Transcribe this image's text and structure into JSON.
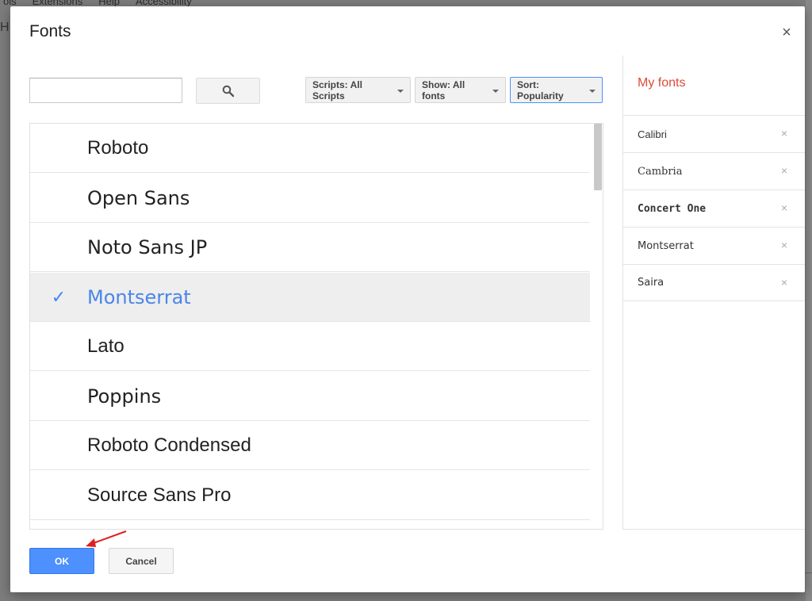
{
  "background": {
    "menu_items": [
      "ols",
      "Extensions",
      "Help",
      "Accessibility"
    ],
    "left_fragment": "He"
  },
  "dialog": {
    "title": "Fonts",
    "close_glyph": "×"
  },
  "search": {
    "value": "",
    "placeholder": "",
    "button_icon": "search-icon"
  },
  "filters": {
    "scripts_label": "Scripts: All Scripts",
    "show_label": "Show: All fonts",
    "sort_label": "Sort: Popularity"
  },
  "font_list": {
    "selected_index": 3,
    "check_glyph": "✓",
    "items": [
      {
        "label": "Roboto",
        "font": "\"Liberation Sans\", sans-serif"
      },
      {
        "label": "Open Sans",
        "font": "\"DejaVu Sans\", sans-serif"
      },
      {
        "label": "Noto Sans JP",
        "font": "\"DejaVu Sans\", sans-serif"
      },
      {
        "label": "Montserrat",
        "font": "\"DejaVu Sans\", sans-serif"
      },
      {
        "label": "Lato",
        "font": "\"Liberation Sans\", sans-serif"
      },
      {
        "label": "Poppins",
        "font": "\"DejaVu Sans\", sans-serif"
      },
      {
        "label": "Roboto Condensed",
        "font": "\"Liberation Sans\", sans-serif"
      },
      {
        "label": "Source Sans Pro",
        "font": "\"Liberation Sans\", sans-serif"
      }
    ]
  },
  "my_fonts": {
    "title": "My fonts",
    "remove_glyph": "×",
    "items": [
      {
        "label": "Calibri",
        "font": "\"Liberation Sans\", sans-serif",
        "weight": "normal"
      },
      {
        "label": "Cambria",
        "font": "\"DejaVu Serif\", serif",
        "weight": "normal"
      },
      {
        "label": "Concert One",
        "font": "\"DejaVu Sans Mono\", monospace",
        "weight": "bold"
      },
      {
        "label": "Montserrat",
        "font": "\"DejaVu Sans\", sans-serif",
        "weight": "normal"
      },
      {
        "label": "Saira",
        "font": "\"DejaVu Sans\", sans-serif",
        "weight": "normal"
      }
    ]
  },
  "footer": {
    "ok_label": "OK",
    "cancel_label": "Cancel"
  },
  "colors": {
    "accent_blue": "#4d90fe",
    "selected_text": "#4a86e8",
    "my_fonts_title": "#dd4b39",
    "annotation_arrow": "#e02020"
  }
}
